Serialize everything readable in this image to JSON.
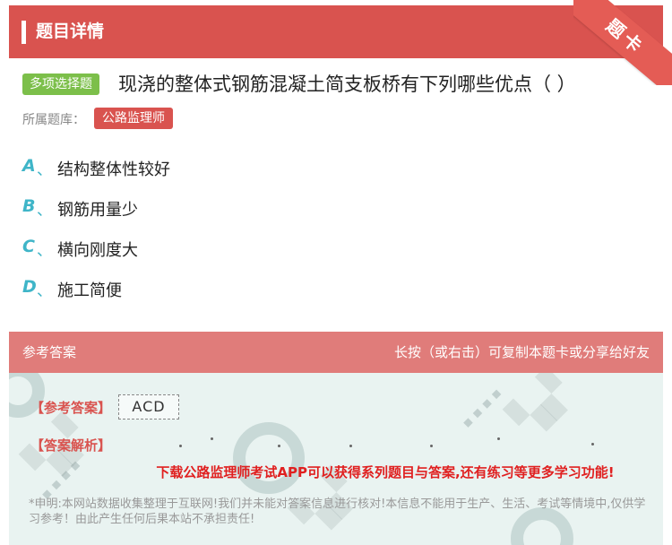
{
  "header": {
    "title": "题目详情"
  },
  "ribbon": {
    "label": "题卡"
  },
  "question": {
    "type_label": "多项选择题",
    "text": "现浇的整体式钢筋混凝土简支板桥有下列哪些优点（   ）",
    "bank_label": "所属题库：",
    "bank_name": "公路监理师"
  },
  "options": [
    {
      "letter": "A",
      "sep": "、",
      "text": "结构整体性较好"
    },
    {
      "letter": "B",
      "sep": "、",
      "text": "钢筋用量少"
    },
    {
      "letter": "C",
      "sep": "、",
      "text": "横向刚度大"
    },
    {
      "letter": "D",
      "sep": "、",
      "text": "施工简便"
    }
  ],
  "answer_panel": {
    "title": "参考答案",
    "hint": "长按（或右击）可复制本题卡或分享给好友",
    "ref_label": "【参考答案】",
    "ref_value": "ACD",
    "analysis_label": "【答案解析】",
    "promo": "下载公路监理师考试APP可以获得系列题目与答案,还有练习等更多学习功能!",
    "disclaimer": "*申明:本网站数据收集整理于互联网!我们并未能对答案信息进行核对!本信息不能用于生产、生活、考试等情境中,仅供学习参考！由此产生任何后果本站不承担责任!"
  },
  "colors": {
    "header_red": "#d9534f",
    "answer_head": "#e07c7a",
    "type_green": "#7cbf4a",
    "option_letter": "#3fb5c8",
    "answer_bg": "#e9f3f1",
    "promo_red": "#e02020"
  }
}
